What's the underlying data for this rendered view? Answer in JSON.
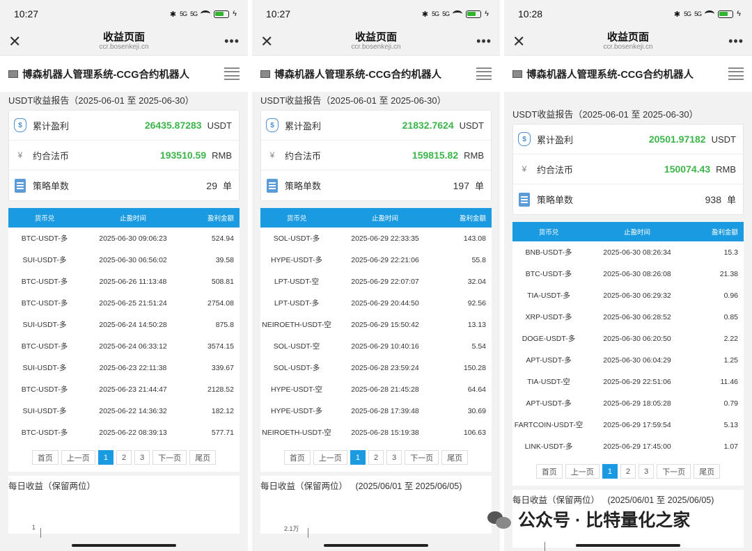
{
  "panels": [
    {
      "time": "10:27",
      "status_sig": "5G",
      "page_title": "收益页面",
      "domain": "ccr.bosenkeji.cn",
      "app_name": "博森机器人管理系统-CCG合约机器人",
      "report_title": "USDT收益报告（2025-06-01 至 2025-06-30）",
      "summary": [
        {
          "label": "累计盈利",
          "value": "26435.87283",
          "unit": "USDT",
          "icon": "money-bag-icon"
        },
        {
          "label": "约合法币",
          "value": "193510.59",
          "unit": "RMB",
          "icon": "yen-icon"
        },
        {
          "label": "策略单数",
          "value": "29",
          "unit": "单",
          "icon": "document-icon"
        }
      ],
      "table_headers": [
        "货币兑",
        "止盈时间",
        "盈利金额"
      ],
      "rows": [
        [
          "BTC-USDT-多",
          "2025-06-30 09:06:23",
          "524.94"
        ],
        [
          "SUI-USDT-多",
          "2025-06-30 06:56:02",
          "39.58"
        ],
        [
          "BTC-USDT-多",
          "2025-06-26 11:13:48",
          "508.81"
        ],
        [
          "BTC-USDT-多",
          "2025-06-25 21:51:24",
          "2754.08"
        ],
        [
          "SUI-USDT-多",
          "2025-06-24 14:50:28",
          "875.8"
        ],
        [
          "BTC-USDT-多",
          "2025-06-24 06:33:12",
          "3574.15"
        ],
        [
          "SUI-USDT-多",
          "2025-06-23 22:11:38",
          "339.67"
        ],
        [
          "BTC-USDT-多",
          "2025-06-23 21:44:47",
          "2128.52"
        ],
        [
          "SUI-USDT-多",
          "2025-06-22 14:36:32",
          "182.12"
        ],
        [
          "BTC-USDT-多",
          "2025-06-22 08:39:13",
          "577.71"
        ]
      ],
      "pager": [
        "首页",
        "上一页",
        "1",
        "2",
        "3",
        "下一页",
        "尾页"
      ],
      "daily_title": "每日收益（保留两位）",
      "daily_range": "",
      "ytick": "1"
    },
    {
      "time": "10:27",
      "status_sig": "5G",
      "page_title": "收益页面",
      "domain": "ccr.bosenkeji.cn",
      "app_name": "博森机器人管理系统-CCG合约机器人",
      "report_title": "USDT收益报告（2025-06-01 至 2025-06-30）",
      "summary": [
        {
          "label": "累计盈利",
          "value": "21832.7624",
          "unit": "USDT",
          "icon": "money-bag-icon"
        },
        {
          "label": "约合法币",
          "value": "159815.82",
          "unit": "RMB",
          "icon": "yen-icon"
        },
        {
          "label": "策略单数",
          "value": "197",
          "unit": "单",
          "icon": "document-icon"
        }
      ],
      "table_headers": [
        "货币兑",
        "止盈时间",
        "盈利金额"
      ],
      "rows": [
        [
          "SOL-USDT-多",
          "2025-06-29 22:33:35",
          "143.08"
        ],
        [
          "HYPE-USDT-多",
          "2025-06-29 22:21:06",
          "55.8"
        ],
        [
          "LPT-USDT-空",
          "2025-06-29 22:07:07",
          "32.04"
        ],
        [
          "LPT-USDT-多",
          "2025-06-29 20:44:50",
          "92.56"
        ],
        [
          "NEIROETH-USDT-空",
          "2025-06-29 15:50:42",
          "13.13"
        ],
        [
          "SOL-USDT-空",
          "2025-06-29 10:40:16",
          "5.54"
        ],
        [
          "SOL-USDT-多",
          "2025-06-28 23:59:24",
          "150.28"
        ],
        [
          "HYPE-USDT-空",
          "2025-06-28 21:45:28",
          "64.64"
        ],
        [
          "HYPE-USDT-多",
          "2025-06-28 17:39:48",
          "30.69"
        ],
        [
          "NEIROETH-USDT-空",
          "2025-06-28 15:19:38",
          "106.63"
        ]
      ],
      "pager": [
        "首页",
        "上一页",
        "1",
        "2",
        "3",
        "下一页",
        "尾页"
      ],
      "daily_title": "每日收益（保留两位）",
      "daily_range": "(2025/06/01 至 2025/06/05)",
      "ytick": "2.1万"
    },
    {
      "time": "10:28",
      "status_sig": "5G",
      "page_title": "收益页面",
      "domain": "ccr.bosenkeji.cn",
      "app_name": "博森机器人管理系统-CCG合约机器人",
      "report_title": "USDT收益报告（2025-06-01 至 2025-06-30）",
      "summary": [
        {
          "label": "累计盈利",
          "value": "20501.97182",
          "unit": "USDT",
          "icon": "money-bag-icon"
        },
        {
          "label": "约合法币",
          "value": "150074.43",
          "unit": "RMB",
          "icon": "yen-icon"
        },
        {
          "label": "策略单数",
          "value": "938",
          "unit": "单",
          "icon": "document-icon"
        }
      ],
      "table_headers": [
        "货币兑",
        "止盈时间",
        "盈利金额"
      ],
      "rows": [
        [
          "BNB-USDT-多",
          "2025-06-30 08:26:34",
          "15.3"
        ],
        [
          "BTC-USDT-多",
          "2025-06-30 08:26:08",
          "21.38"
        ],
        [
          "TIA-USDT-多",
          "2025-06-30 06:29:32",
          "0.96"
        ],
        [
          "XRP-USDT-多",
          "2025-06-30 06:28:52",
          "0.85"
        ],
        [
          "DOGE-USDT-多",
          "2025-06-30 06:20:50",
          "2.22"
        ],
        [
          "APT-USDT-多",
          "2025-06-30 06:04:29",
          "1.25"
        ],
        [
          "TIA-USDT-空",
          "2025-06-29 22:51:06",
          "11.46"
        ],
        [
          "APT-USDT-多",
          "2025-06-29 18:05:28",
          "0.79"
        ],
        [
          "FARTCOIN-USDT-空",
          "2025-06-29 17:59:54",
          "5.13"
        ],
        [
          "LINK-USDT-多",
          "2025-06-29 17:45:00",
          "1.07"
        ]
      ],
      "pager": [
        "首页",
        "上一页",
        "1",
        "2",
        "3",
        "下一页",
        "尾页"
      ],
      "daily_title": "每日收益（保留两位）",
      "daily_range": "(2025/06/01 至 2025/06/05)",
      "ytick": ""
    }
  ],
  "watermark": "公众号 · 比特量化之家",
  "colors": {
    "accent": "#1a9ae0",
    "profit_green": "#3bb54a"
  }
}
